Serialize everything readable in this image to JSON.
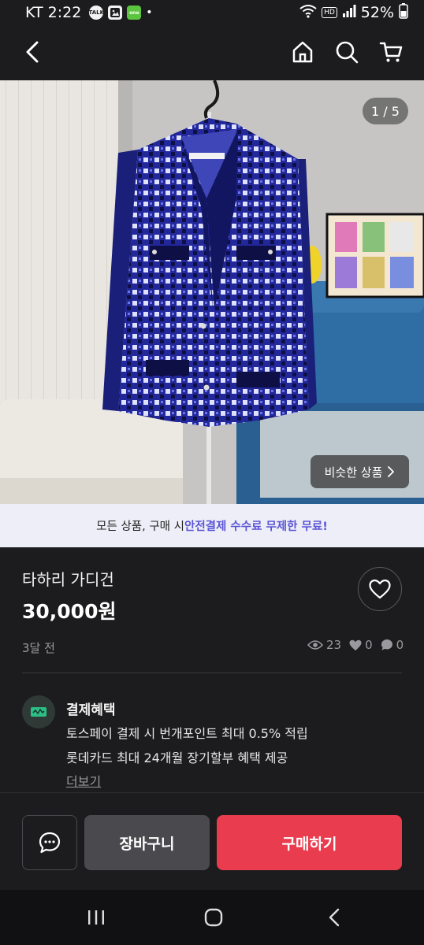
{
  "status_bar": {
    "carrier_time": "KT 2:22",
    "notif_talk": "TALK",
    "notif_one": "one",
    "dot": "•",
    "hd": "HD",
    "battery": "52%"
  },
  "header": {
    "icons": [
      "back-icon",
      "home-icon",
      "search-icon",
      "cart-icon"
    ]
  },
  "photo": {
    "page_counter": "1 / 5",
    "similar_label": "비슷한 상품",
    "colors": {
      "jacket": "#22279a",
      "check": "#dfe2ff",
      "sofa": "#2f6da5"
    }
  },
  "promo": {
    "prefix": "모든 상품, 구매 시 ",
    "highlight": "안전결제 수수료 무제한 무료!"
  },
  "product": {
    "title": "타하리 가디건",
    "price": "30,000원",
    "posted": "3달 전",
    "views": "23",
    "likes": "0",
    "chats": "0"
  },
  "benefit": {
    "title": "결제혜택",
    "lines": [
      "토스페이 결제 시 번개포인트 최대 0.5% 적립",
      "롯데카드 최대 24개월 장기할부 혜택 제공"
    ],
    "more": "더보기"
  },
  "actions": {
    "cart_label": "장바구니",
    "buy_label": "구매하기",
    "buy_color": "#ea3c4f"
  }
}
